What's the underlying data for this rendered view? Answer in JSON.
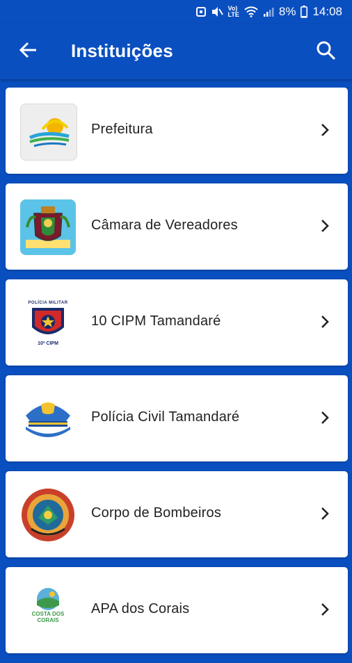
{
  "status_bar": {
    "battery": "8%",
    "time": "14:08",
    "network_label": "Vo) LTE"
  },
  "app_bar": {
    "title": "Instituições",
    "back_icon": "arrow-left-icon",
    "search_icon": "search-icon"
  },
  "institutions": [
    {
      "label": "Prefeitura",
      "logo": "prefeitura-logo"
    },
    {
      "label": "Câmara de Vereadores",
      "logo": "camara-coat-of-arms-logo"
    },
    {
      "label": "10 CIPM Tamandaré",
      "logo": "policia-militar-badge-logo",
      "logo_caption": "10ª CIPM",
      "logo_header": "POLÍCIA MILITAR"
    },
    {
      "label": "Polícia Civil Tamandaré",
      "logo": "police-cap-logo"
    },
    {
      "label": "Corpo de Bombeiros",
      "logo": "bombeiros-seal-logo"
    },
    {
      "label": "APA dos Corais",
      "logo": "apa-corais-logo",
      "logo_caption": "COSTA DOS CORAIS"
    }
  ],
  "colors": {
    "primary": "#0a4fc0",
    "card": "#ffffff",
    "text": "#222222"
  }
}
